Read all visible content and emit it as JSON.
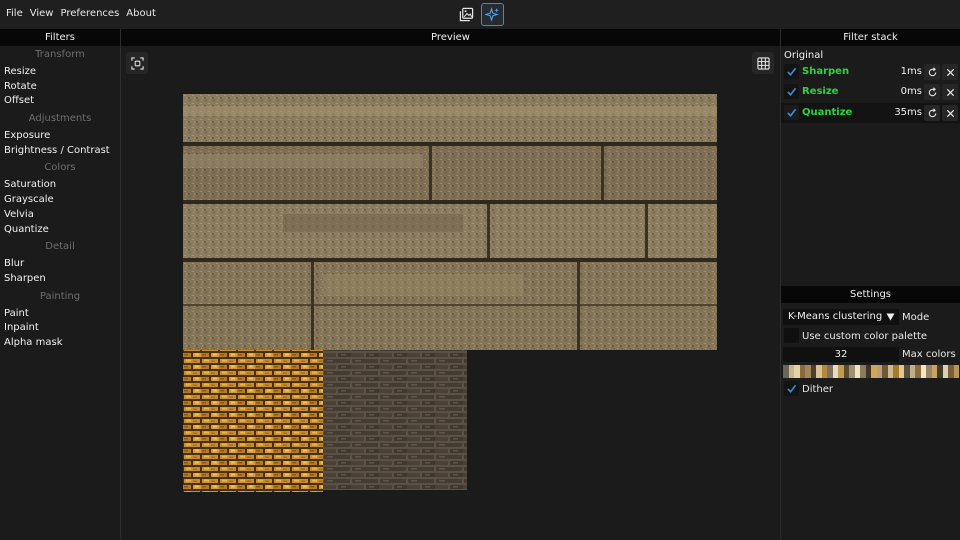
{
  "menu": {
    "file": "File",
    "view": "View",
    "preferences": "Preferences",
    "about": "About"
  },
  "panels": {
    "filters": "Filters",
    "preview": "Preview",
    "filter_stack": "Filter stack",
    "settings": "Settings"
  },
  "filters": {
    "transform": {
      "title": "Transform",
      "items": [
        "Resize",
        "Rotate",
        "Offset"
      ]
    },
    "adjustments": {
      "title": "Adjustments",
      "items": [
        "Exposure",
        "Brightness / Contrast"
      ]
    },
    "colors": {
      "title": "Colors",
      "items": [
        "Saturation",
        "Grayscale",
        "Velvia",
        "Quantize"
      ]
    },
    "detail": {
      "title": "Detail",
      "items": [
        "Blur",
        "Sharpen"
      ]
    },
    "painting": {
      "title": "Painting",
      "items": [
        "Paint",
        "Inpaint",
        "Alpha mask"
      ]
    }
  },
  "stack": {
    "original": "Original",
    "items": [
      {
        "name": "Sharpen",
        "time": "1ms",
        "checked": true
      },
      {
        "name": "Resize",
        "time": "0ms",
        "checked": true
      },
      {
        "name": "Quantize",
        "time": "35ms",
        "checked": true
      }
    ]
  },
  "settings": {
    "mode_value": "K-Means clustering",
    "mode_label": "Mode",
    "custom_palette_label": "Use custom color palette",
    "custom_palette_checked": false,
    "max_colors_value": "32",
    "max_colors_label": "Max colors",
    "dither_label": "Dither",
    "dither_checked": true,
    "palette": [
      "#6b6459",
      "#c8b68e",
      "#e5d2a6",
      "#8a6a3a",
      "#a1865c",
      "#4b3f30",
      "#d9c393",
      "#b58a3f",
      "#7d7260",
      "#e7dcc0",
      "#c29a52",
      "#5c4a2d",
      "#9f8f74",
      "#efe3c4",
      "#8c7b5a",
      "#3f3527",
      "#d4a650",
      "#b3a27f",
      "#6f5838",
      "#cdb88f",
      "#a67a2e",
      "#e3c88a",
      "#57503f",
      "#bfae8c",
      "#8d6d3c",
      "#f1e6cc",
      "#9a8461",
      "#c9a35f",
      "#443a2c",
      "#ddd0b2",
      "#7a5f35",
      "#b7945a"
    ]
  },
  "colors": {
    "accent": "#3d8bd9",
    "active_filter": "#2fd33f",
    "check": "#3d8bd9"
  },
  "icons": {
    "gallery_mode": "image-gallery-icon",
    "filter_mode": "sparkles-icon",
    "fit_view": "fit-view-icon",
    "grid": "grid-icon",
    "reset": "reset-icon",
    "remove": "close-icon",
    "dropdown": "triangle-down-icon"
  }
}
